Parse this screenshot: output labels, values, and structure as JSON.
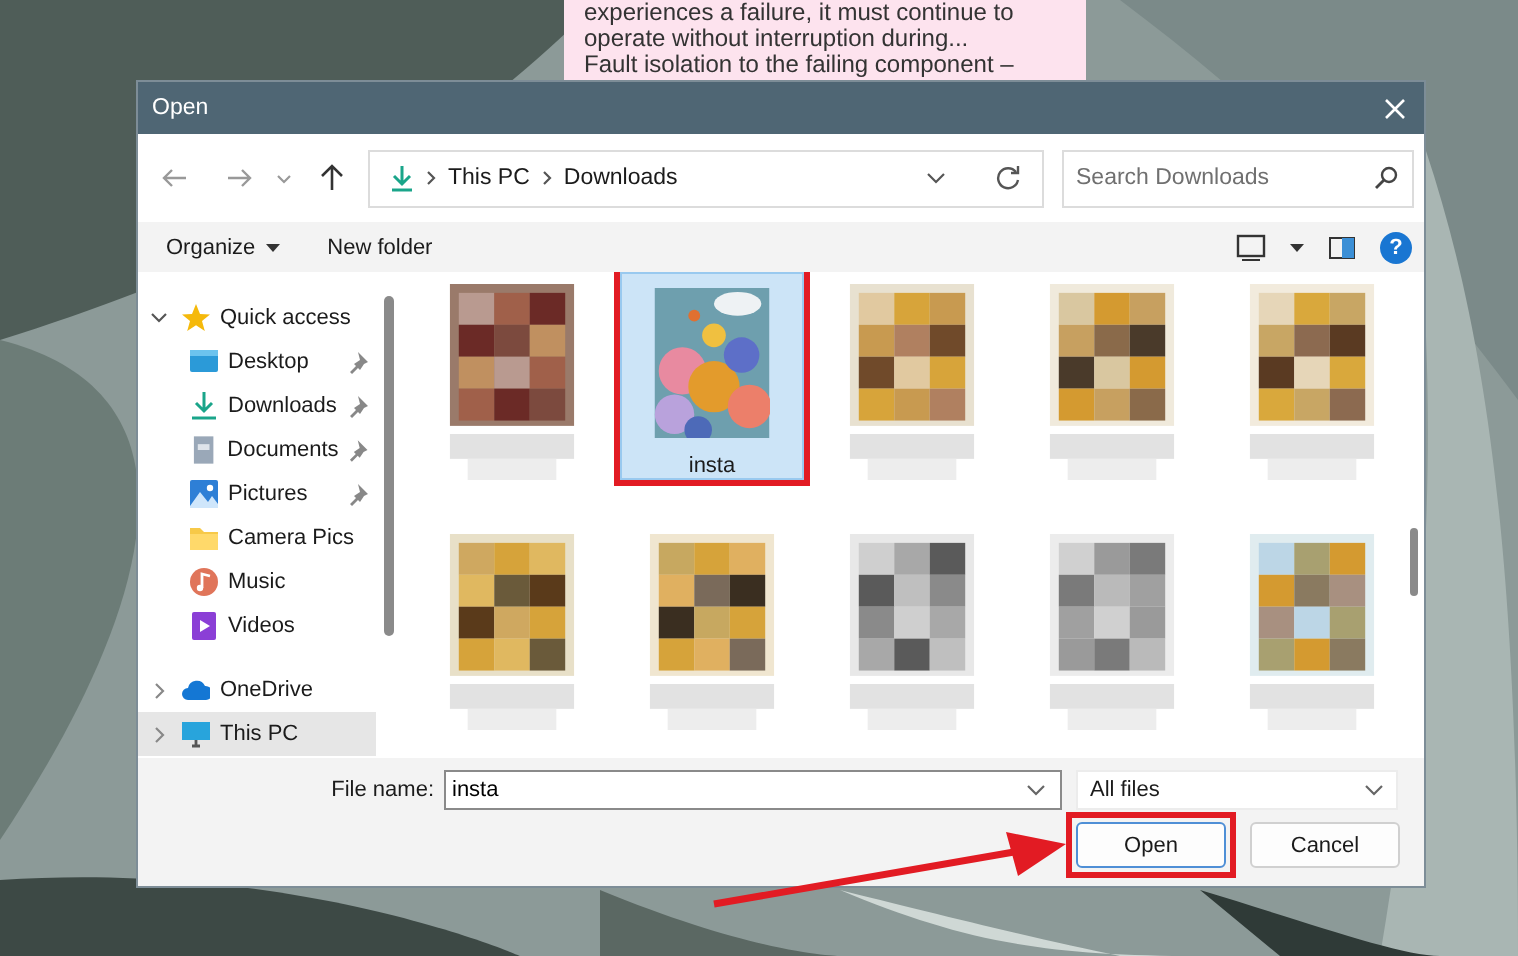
{
  "note": {
    "lines": [
      "experiences a failure, it must continue to",
      "operate without interruption during...",
      "Fault isolation to the failing component –"
    ]
  },
  "window": {
    "title": "Open"
  },
  "address": {
    "path": [
      "This PC",
      "Downloads"
    ]
  },
  "search": {
    "placeholder": "Search Downloads"
  },
  "commands": [
    {
      "label": "Organize",
      "menu": true
    },
    {
      "label": "New folder",
      "menu": false
    }
  ],
  "help": {
    "label": "?"
  },
  "sidebar": {
    "items": [
      {
        "label": "Quick access",
        "expanded": true,
        "selected": false,
        "children": [
          {
            "label": "Desktop",
            "pinned": true
          },
          {
            "label": "Downloads",
            "pinned": true
          },
          {
            "label": "Documents",
            "pinned": true
          },
          {
            "label": "Pictures",
            "pinned": true
          },
          {
            "label": "Camera Pics",
            "pinned": false
          },
          {
            "label": "Music",
            "pinned": false
          },
          {
            "label": "Videos",
            "pinned": false
          }
        ]
      },
      {
        "label": "OneDrive",
        "expanded": false,
        "selected": false
      },
      {
        "label": "This PC",
        "expanded": false,
        "selected": true
      }
    ]
  },
  "files": [
    {
      "kind": "picture",
      "selected": false
    },
    {
      "kind": "picture",
      "name": "insta",
      "selected": true
    },
    {
      "kind": "picture",
      "selected": false
    },
    {
      "kind": "picture",
      "selected": false
    },
    {
      "kind": "picture",
      "selected": false
    },
    {
      "kind": "picture",
      "selected": false
    },
    {
      "kind": "picture",
      "selected": false
    },
    {
      "kind": "picture",
      "selected": false
    },
    {
      "kind": "picture",
      "selected": false
    },
    {
      "kind": "picture",
      "selected": false
    }
  ],
  "file_name": {
    "label": "File name:",
    "value": "insta"
  },
  "file_type": {
    "value": "All files"
  },
  "buttons": [
    {
      "label": "Open",
      "highlighted": true
    },
    {
      "label": "Cancel",
      "highlighted": false
    }
  ]
}
